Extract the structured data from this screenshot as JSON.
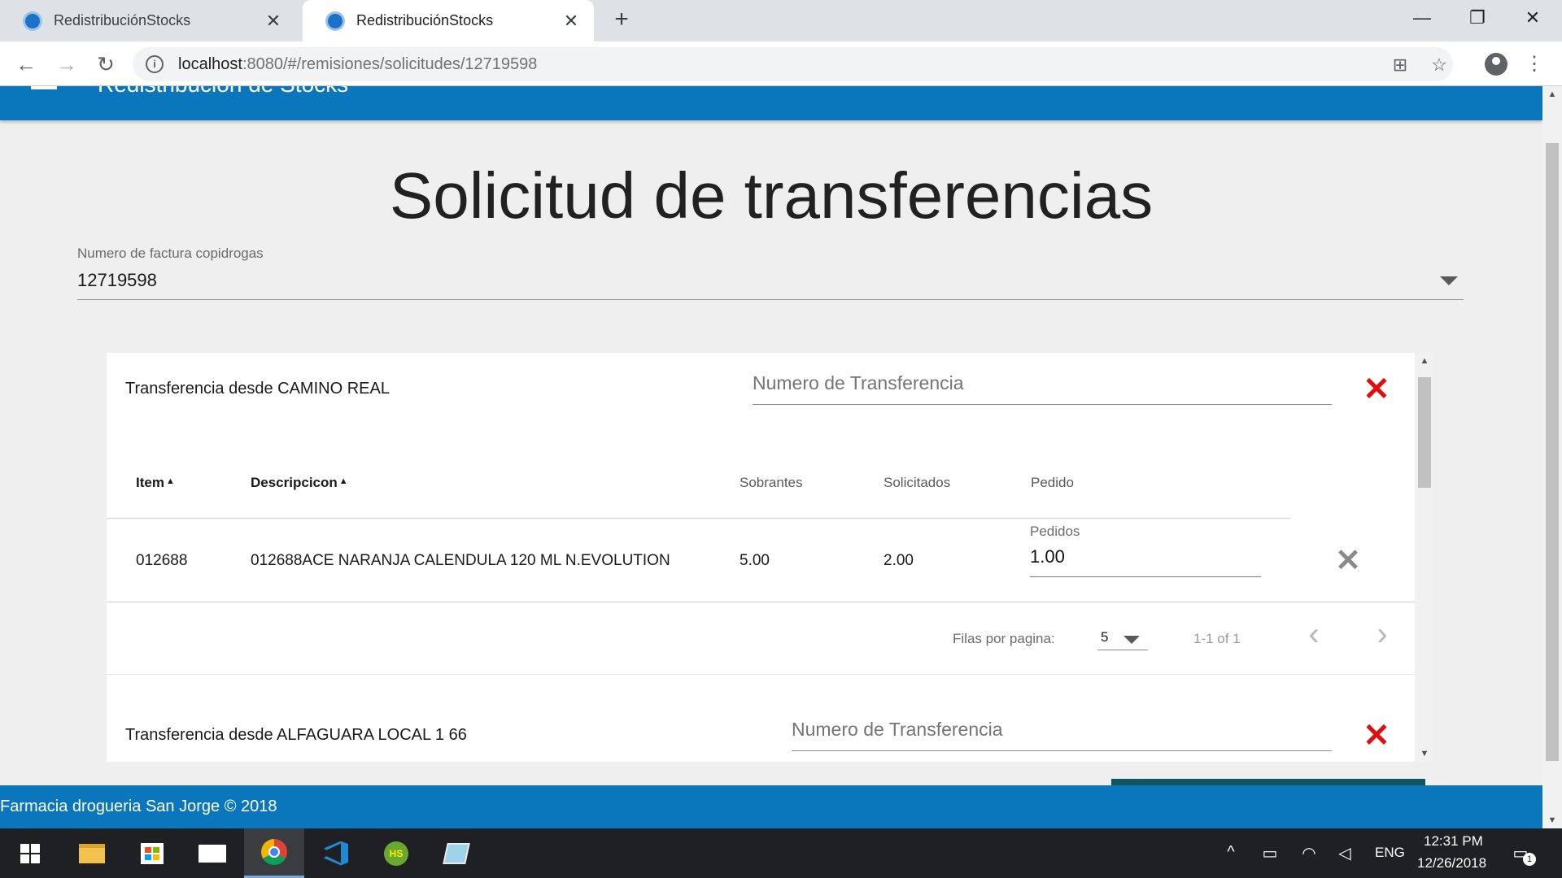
{
  "browser": {
    "tabs": [
      {
        "title": "RedistribuciónStocks",
        "active": false
      },
      {
        "title": "RedistribuciónStocks",
        "active": true
      }
    ],
    "new_tab": "+",
    "url_host": "localhost",
    "url_rest": ":8080/#/remisiones/solicitudes/12719598",
    "window_controls": {
      "minimize": "—",
      "restore": "❐",
      "close": "✕"
    }
  },
  "app": {
    "title": "Redistribución de Stocks",
    "colors": {
      "primary": "#0a77bd",
      "danger": "#e00f0f",
      "button": "#0e5661"
    }
  },
  "page": {
    "title": "Solicitud de transferencias",
    "invoice_select": {
      "label": "Numero de factura copidrogas",
      "value": "12719598"
    }
  },
  "transfers": [
    {
      "heading": "Transferencia desde CAMINO REAL",
      "transfer_number_placeholder": "Numero de Transferencia",
      "table": {
        "headers": {
          "item": "Item",
          "descripcion": "Descripcicon",
          "sobrantes": "Sobrantes",
          "solicitados": "Solicitados",
          "pedido": "Pedido"
        },
        "sort_icon": "▲",
        "rows": [
          {
            "item": "012688",
            "descripcion": "012688ACE NARANJA CALENDULA 120 ML N.EVOLUTION",
            "sobrantes": "5.00",
            "solicitados": "2.00",
            "pedidos_label": "Pedidos",
            "pedidos_value": "1.00"
          }
        ]
      },
      "pagination": {
        "rows_label": "Filas por pagina:",
        "rows_per_page": "5",
        "range": "1-1 of 1"
      }
    },
    {
      "heading": "Transferencia desde ALFAGUARA LOCAL 1 66",
      "transfer_number_placeholder": "Numero de Transferencia"
    }
  ],
  "footer": {
    "text": "Farmacia drogueria San Jorge © 2018"
  },
  "taskbar": {
    "language": "ENG",
    "time": "12:31 PM",
    "date": "12/26/2018",
    "notifications": "1"
  }
}
